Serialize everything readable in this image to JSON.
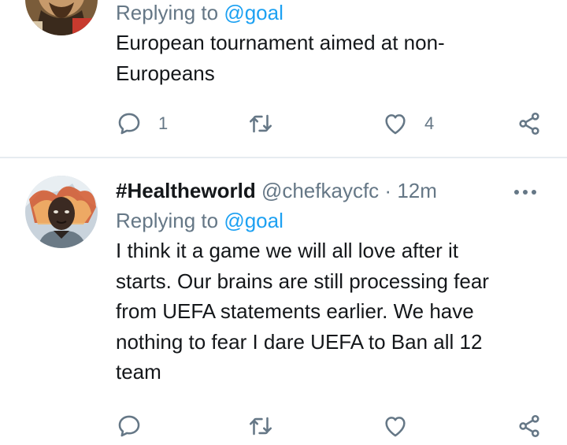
{
  "tweets": [
    {
      "replying_prefix": "Replying to ",
      "replying_to": "@goal",
      "text_lines": [
        "European tournament aimed at non-",
        "Europeans"
      ],
      "reply_count": "1",
      "retweet_count": "",
      "like_count": "4"
    },
    {
      "display_name": "#Healtheworld",
      "handle": "@chefkaycfc",
      "separator": "·",
      "time": "12m",
      "replying_prefix": "Replying to ",
      "replying_to": "@goal",
      "text_lines": [
        "I think it a game we will all love after it",
        "starts. Our brains are still processing fear",
        "from UEFA statements earlier. We have",
        "nothing to fear I dare UEFA to Ban all 12",
        "team"
      ],
      "reply_count": "",
      "retweet_count": "",
      "like_count": ""
    }
  ],
  "icons": {
    "reply": "speech-bubble-icon",
    "retweet": "retweet-icon",
    "like": "heart-icon",
    "share": "share-icon",
    "more": "more-dots-icon"
  },
  "colors": {
    "text": "#14171a",
    "secondary": "#657786",
    "link": "#1da1f2",
    "divider": "#e6ecf0"
  }
}
